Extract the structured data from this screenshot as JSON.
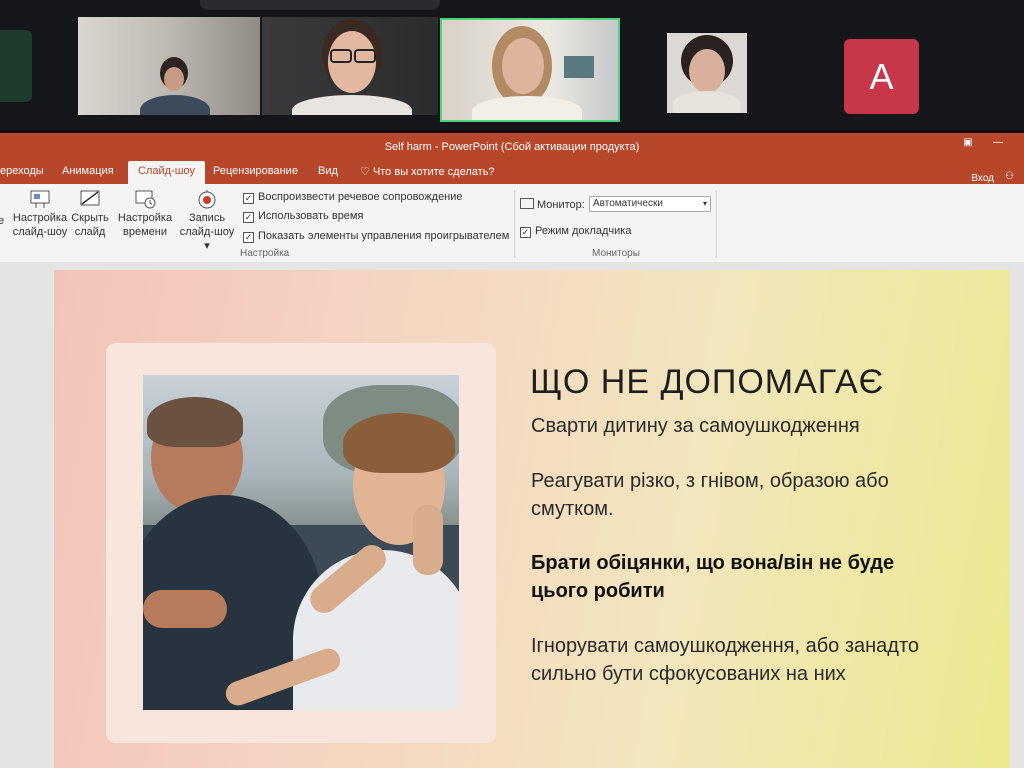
{
  "zoom": {
    "participants": [
      {
        "name": "participant-1",
        "kind": "video"
      },
      {
        "name": "participant-2",
        "kind": "video"
      },
      {
        "name": "participant-3",
        "kind": "video",
        "active_speaker": true
      },
      {
        "name": "participant-4",
        "kind": "video"
      },
      {
        "name": "participant-5",
        "kind": "avatar",
        "initial": "A",
        "color": "#c8364a"
      }
    ],
    "accent_color": "#4fd27c"
  },
  "powerpoint": {
    "window_title": "Self harm  -  PowerPoint (Сбой активации продукта)",
    "accent_color": "#b7472a",
    "tabs": [
      "ереходы",
      "Анимация",
      "Слайд-шоу",
      "Рецензирование",
      "Вид"
    ],
    "active_tab": "Слайд-шоу",
    "tell_me": "Что вы хотите сделать?",
    "sign_in": "Вход",
    "ribbon": {
      "buttons": [
        {
          "label_1": "Настройка",
          "label_2": "слайд-шоу",
          "icon": "slideshow-setup-icon"
        },
        {
          "label_1": "Скрыть",
          "label_2": "слайд",
          "icon": "hide-slide-icon"
        },
        {
          "label_1": "Настройка",
          "label_2": "времени",
          "icon": "rehearse-timings-icon"
        },
        {
          "label_1": "Запись",
          "label_2": "слайд-шоу ▾",
          "icon": "record-icon"
        }
      ],
      "checkboxes": [
        {
          "label": "Воспроизвести речевое сопровождение",
          "checked": true
        },
        {
          "label": "Использовать время",
          "checked": true
        },
        {
          "label": "Показать элементы управления проигрывателем",
          "checked": true
        }
      ],
      "group_setup_label": "Настройка",
      "monitor_label": "Монитор:",
      "monitor_value": "Автоматически",
      "presenter_view_label": "Режим докладчика",
      "presenter_view_checked": true,
      "group_monitors_label": "Мониторы"
    }
  },
  "slide": {
    "title": "ЩО НЕ ДОПОМАГАЄ",
    "items": [
      {
        "text": "Сварти дитину за самоушкодження",
        "bold": false
      },
      {
        "text": "Реагувати різко, з гнівом, образою або смутком.",
        "bold": false
      },
      {
        "text": "Брати обіцянки, що вона/він не буде цього робити",
        "bold": true
      },
      {
        "text": "Ігнорувати самоушкодження, або занадто сильно бути  сфокусованих на них",
        "bold": false
      }
    ],
    "photo": "father-and-teen-son-photo"
  }
}
